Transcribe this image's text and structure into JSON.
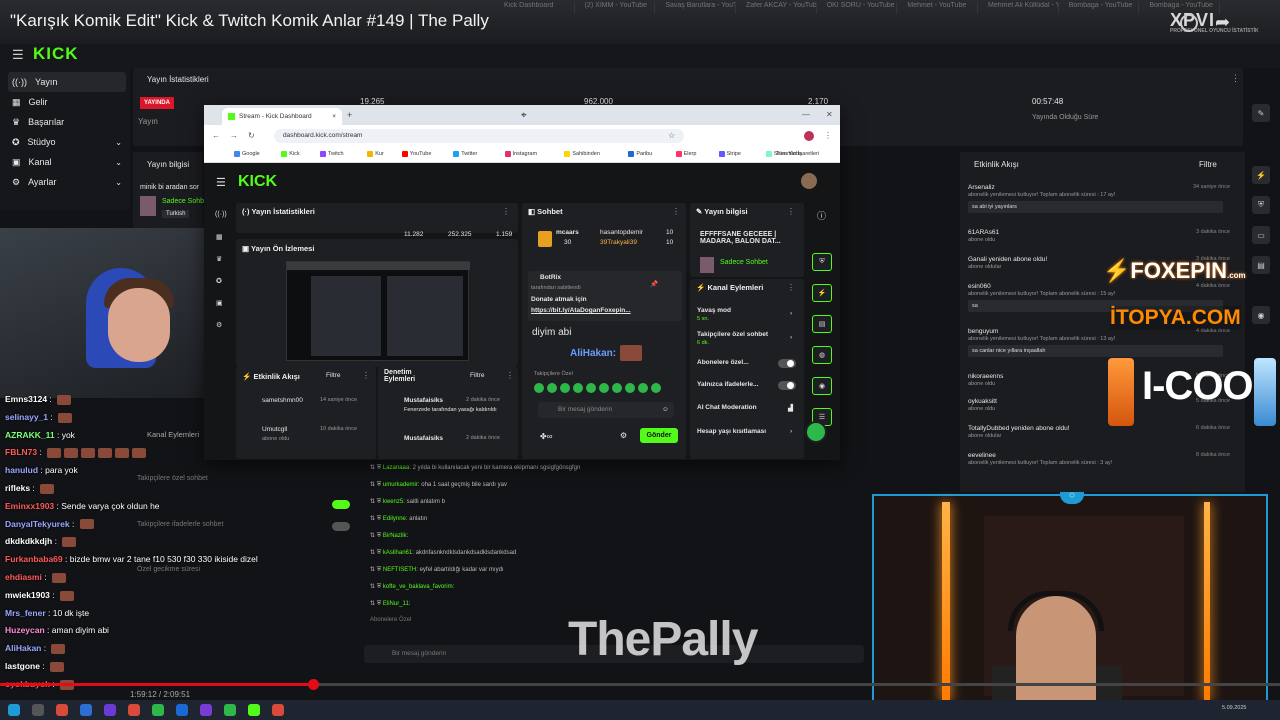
{
  "video_title": "\"Karışık Komik Edit\" Kick & Twitch Komik Anlar #149 | The Pally",
  "top_tabs": [
    "Kick Dashboard",
    "(2) XIMM - YouTube",
    "Savaş Barutlara - YouTube",
    "Zafer AKCAY - YouTube",
    "OKİ SORU - YouTube",
    "Mehmet - YouTube",
    "Mehmet Ali Küllüdal - YouTube",
    "Bombaga - YouTube",
    "Bombaga - YouTube"
  ],
  "watermark": {
    "text": "XPVI",
    "sub": "PROFESYONEL OYUNCU İSTATİSTİK"
  },
  "bg_app": {
    "logo": "KICK",
    "sidebar": [
      {
        "label": "Yayın",
        "icon": "broadcast-icon",
        "chev": ""
      },
      {
        "label": "Gelir",
        "icon": "money-icon",
        "chev": ""
      },
      {
        "label": "Başarılar",
        "icon": "trophy-icon",
        "chev": ""
      },
      {
        "label": "Stüdyo",
        "icon": "studio-icon",
        "chev": "⌄"
      },
      {
        "label": "Kanal",
        "icon": "channel-icon",
        "chev": "⌄"
      },
      {
        "label": "Ayarlar",
        "icon": "settings-icon",
        "chev": "⌄"
      }
    ],
    "stats_title": "Yayın İstatistikleri",
    "live_label": "YAYINDA",
    "yayin_label": "Yayın",
    "stat1": "19.265",
    "stat2": "962.000",
    "stat3": "2.170",
    "duration": "00:57:48",
    "duration_label": "Yayında Olduğu Süre",
    "yayin_bilgisi": "Yayın bilgisi",
    "stream_title_short": "minik bi aradan sor",
    "category": "Sadece Sohbet",
    "language": "Turkish",
    "activity_title": "Etkinlik Akışı",
    "filter": "Filtre",
    "events": [
      {
        "user": "Arsenaliz",
        "text": "abonelik yenilemesi kutluyor! Toplam abonelik süresi : 17 ay!",
        "time": "34 saniye önce",
        "msg": "sa abi iyi yayınlars"
      },
      {
        "user": "61ARAs61",
        "text": "abone oldu",
        "time": "3 dakika önce",
        "msg": ""
      },
      {
        "user": "Ganali yeniden abone oldu!",
        "text": "abone oldular",
        "time": "3 dakika önce",
        "msg": ""
      },
      {
        "user": "esin060",
        "text": "abonelik yenilemesi kutluyor! Toplam abonelik süresi : 15 ay!",
        "time": "4 dakika önce",
        "msg": "sa"
      },
      {
        "user": "benguyum",
        "text": "abonelik yenilemesi kutluyor! Toplam abonelik süresi : 13 ay!",
        "time": "4 dakika önce",
        "msg": "sa canlar nice yıllara inşaallah"
      },
      {
        "user": "nikoraeenns",
        "text": "abone oldu",
        "time": "5 dakika önce",
        "msg": ""
      },
      {
        "user": "oykuaksitt",
        "text": "abone oldu",
        "time": "5 dakika önce",
        "msg": ""
      },
      {
        "user": "TotallyDubbed yeniden abone oldu!",
        "text": "abone oldular",
        "time": "6 dakika önce",
        "msg": ""
      },
      {
        "user": "eevelinee",
        "text": "abonelik yenilemesi kutluyor! Toplam abonelik süresi : 3 ay!",
        "time": "8 dakika önce",
        "msg": ""
      }
    ]
  },
  "chat_overlay": [
    {
      "user": "Emns3124",
      "color": "#ffffff",
      "text": "",
      "emotes": 1
    },
    {
      "user": "selinayy_1",
      "color": "#9aa7ff",
      "text": "",
      "emotes": 1
    },
    {
      "user": "AZRAKK_11",
      "color": "#7cff7c",
      "text": "yok",
      "emotes": 0
    },
    {
      "user": "FBLN73",
      "color": "#ff5a5a",
      "text": "",
      "emotes": 6
    },
    {
      "user": "hanulud",
      "color": "#9aa7ff",
      "text": "para yok",
      "emotes": 0
    },
    {
      "user": "rifleks",
      "color": "#ffffff",
      "text": "",
      "emotes": 1
    },
    {
      "user": "Eminxx1903",
      "color": "#ff5a5a",
      "text": "Sende varya çok oldun he",
      "emotes": 0
    },
    {
      "user": "DanyalTekyurek",
      "color": "#9aa7ff",
      "text": "",
      "emotes": 1
    },
    {
      "user": "dkdkdkkdjh",
      "color": "#ffffff",
      "text": "",
      "emotes": 1
    },
    {
      "user": "Furkanbaba69",
      "color": "#ff5a5a",
      "text": "bizde bmw var 2 tane f10 530 f30 330 ikiside dizel",
      "emotes": 0
    },
    {
      "user": "ehdiasmi",
      "color": "#ff5a5a",
      "text": "",
      "emotes": 1
    },
    {
      "user": "mwiek1903",
      "color": "#ffffff",
      "text": "",
      "emotes": 1
    },
    {
      "user": "Mrs_fener",
      "color": "#9aa7ff",
      "text": "10 dk işte",
      "emotes": 0
    },
    {
      "user": "Huzeycan",
      "color": "#ff8ad8",
      "text": "aman diyim abi",
      "emotes": 0
    },
    {
      "user": "AliHakan",
      "color": "#9aa7ff",
      "text": "",
      "emotes": 1
    },
    {
      "user": "lastgone",
      "color": "#ffffff",
      "text": "",
      "emotes": 1
    },
    {
      "user": "oyokbuyok",
      "color": "#ff5a5a",
      "text": "",
      "emotes": 1
    }
  ],
  "browser": {
    "tab_title": "Stream - Kick Dashboard",
    "url": "dashboard.kick.com/stream",
    "bookmarks": [
      "Google",
      "Kick",
      "Twitch",
      "Kur",
      "YouTube",
      "Twitter",
      "Instagram",
      "Sahibinden",
      "Paribu",
      "Elerp",
      "Stripe",
      "Streamlabs"
    ],
    "all_bookmarks": "Tüm Yer İşaretleri",
    "logo": "KICK",
    "stats_title": "Yayın İstatistikleri",
    "s1": "11.282",
    "s2": "252.325",
    "s3": "1.159",
    "preview_title": "Yayın Ön İzlemesi",
    "activity_title": "Etkinlik Akışı",
    "filter": "Filtre",
    "act": [
      {
        "user": "sametshmn00",
        "time": "14 saniye önce",
        "sub": ""
      },
      {
        "user": "Umutcgll",
        "time": "10 dakika önce",
        "sub": "abone oldu"
      }
    ],
    "moderation_title": "Denetim Eylemleri",
    "mod": [
      {
        "user": "Mustafaisiks",
        "time": "2 dakika önce",
        "text": "Fenerzede tarafından yasağı kaldırıldı"
      },
      {
        "user": "Mustafaisiks",
        "time": "2 dakika önce",
        "text": ""
      }
    ],
    "chat_title": "Sohbet",
    "top1_user": "mcaars",
    "top1_val": "30",
    "top2_user": "hasantopdemir",
    "top2_val": "10",
    "top3_user": "39Trakyali39",
    "top3_val": "10",
    "pinned_bot": "BotRix",
    "pinned_by": "tarafından sabitlendi",
    "pinned_text": "Donate atmak için",
    "pinned_link": "https://bit.ly/AtaDoganFoxepin...",
    "chat_msg": "diyim abi",
    "chat_user": "AliHakan:",
    "follower_only": "Takipçilere Özel",
    "input_placeholder": "Bir mesaj gönderin",
    "send": "Gönder",
    "info_title": "Yayın bilgisi",
    "stream_title": "EFFFFSANE GECEEE | MADARA, BALON DAT...",
    "category": "Sadece Sohbet",
    "channel_actions": "Kanal Eylemleri",
    "actions": [
      {
        "label": "Yavaş mod",
        "sub": "5 sn."
      },
      {
        "label": "Takipçilere özel sohbet",
        "sub": "6 dk."
      },
      {
        "label": "Abonelere özel...",
        "sub": ""
      },
      {
        "label": "Yalnızca ifadelerle...",
        "sub": ""
      },
      {
        "label": "AI Chat Moderation",
        "sub": ""
      },
      {
        "label": "Hesap yaşı kısıtlaması",
        "sub": ""
      }
    ]
  },
  "bg_chat_log": [
    {
      "user": "Lazanaaa",
      "text": "2 yılda bi kullanılacak yeni bir kamera ekipmanı sgsigfgönsgfgn"
    },
    {
      "user": "umurkademir",
      "text": "oha 1 saat geçmiş bile sardı yav"
    },
    {
      "user": "kwenz5",
      "text": "saitli anlatım b"
    },
    {
      "user": "Edilynne",
      "text": "anlatın"
    },
    {
      "user": "BirNazlik",
      "text": ""
    },
    {
      "user": "kAslihan61",
      "text": "akdnfasnkndklsdankdsadklsdankdsad"
    },
    {
      "user": "NEFTISETH",
      "text": "eyfel abartıldığı kadar var mıydı"
    },
    {
      "user": "kofte_ve_baklava_favorim",
      "text": ""
    },
    {
      "user": "EliNur_11",
      "text": ""
    }
  ],
  "bg_labels": {
    "kanal_eylemleri": "Kanal Eylemleri",
    "takipci_ozel": "Takipçilere özel sohbet",
    "takipci_ifade": "Takipçilere ifadelerle sohbet",
    "ozel_gecikme": "Özel gecikme süresi",
    "abone_ozel": "Abonelere Özel",
    "bottom_placeholder": "Bir mesaj gönderin"
  },
  "sponsors": {
    "foxepin": "FOXEPIN",
    "foxepin_dom": ".com",
    "itopya": "İTOPYA.COM",
    "icool": "I-COOL"
  },
  "overlay_brand": "ThePally",
  "player": {
    "elapsed": "1:59:12 / 2:09:51",
    "progress": 0.245
  },
  "taskbar_date": "5.09.2025",
  "colors": {
    "kick_green": "#53fc18",
    "live_red": "#d9162b",
    "accent_blue": "#1e9bd6",
    "progress_red": "#e30b17"
  }
}
